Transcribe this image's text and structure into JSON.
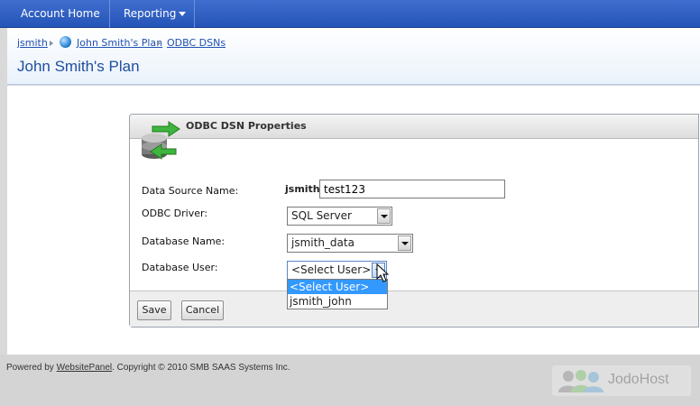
{
  "nav": {
    "account_home": "Account Home",
    "reporting": "Reporting"
  },
  "breadcrumb": {
    "items": [
      "jsmith",
      "John Smith's Plan",
      "ODBC DSNs"
    ]
  },
  "page": {
    "title": "John Smith's Plan"
  },
  "panel": {
    "title": "ODBC DSN Properties",
    "labels": {
      "data_source_name": "Data Source Name:",
      "odbc_driver": "ODBC Driver:",
      "database_name": "Database Name:",
      "database_user": "Database User:"
    },
    "owner_prefix": "jsmith",
    "data_source_name_value": "test123",
    "odbc_driver_value": "SQL Server",
    "database_name_value": "jsmith_data",
    "database_user_value": "<Select User>",
    "database_user_options": [
      "<Select User>",
      "jsmith_john"
    ],
    "buttons": {
      "save": "Save",
      "cancel": "Cancel"
    }
  },
  "footer": {
    "powered_prefix": "Powered by",
    "powered_link": "WebsitePanel",
    "copyright": ". Copyright © 2010 SMB SAAS Systems Inc.",
    "watermark": "JodoHost"
  },
  "colors": {
    "nav_bg": "#2f60c4",
    "title": "#1e4ea0",
    "link": "#2050b0",
    "selected_option": "#3399ff"
  }
}
